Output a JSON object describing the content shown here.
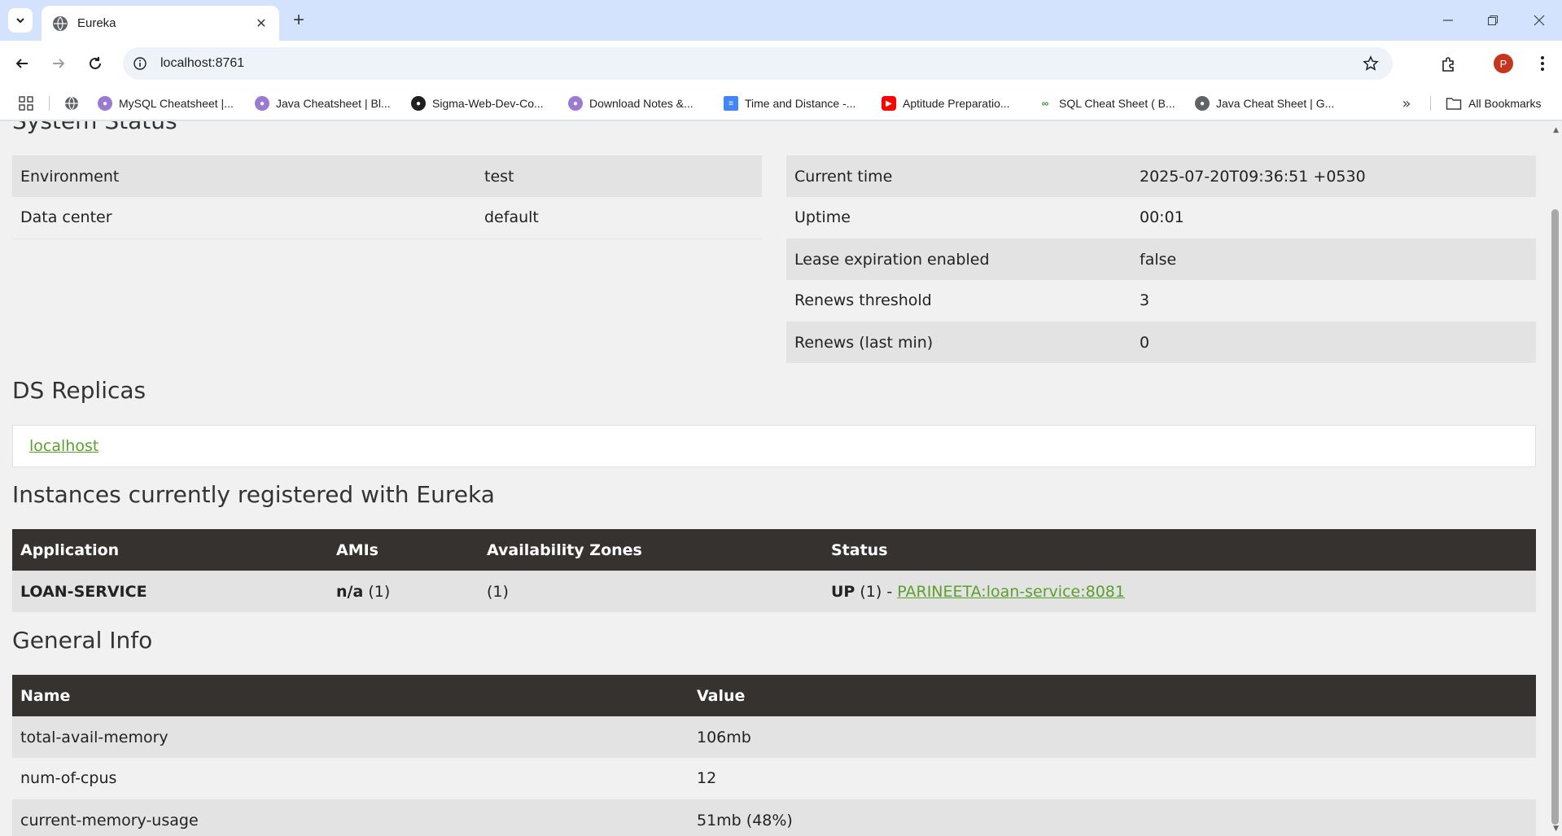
{
  "browser": {
    "tab_title": "Eureka",
    "url": "localhost:8761",
    "profile_initial": "P",
    "bookmarks": [
      {
        "label": "MySQL Cheatsheet |...",
        "icon": "avatar"
      },
      {
        "label": "Java Cheatsheet | Bl...",
        "icon": "avatar"
      },
      {
        "label": "Sigma-Web-Dev-Co...",
        "icon": "github"
      },
      {
        "label": "Download Notes &...",
        "icon": "avatar"
      },
      {
        "label": "Time and Distance -...",
        "icon": "docs"
      },
      {
        "label": "Aptitude Preparatio...",
        "icon": "youtube"
      },
      {
        "label": "SQL Cheat Sheet ( B...",
        "icon": "gfg"
      },
      {
        "label": "Java Cheat Sheet | G...",
        "icon": "globe"
      }
    ],
    "all_bookmarks_label": "All Bookmarks"
  },
  "system_status": {
    "title": "System Status",
    "left_rows": [
      {
        "name": "Environment",
        "value": "test"
      },
      {
        "name": "Data center",
        "value": "default"
      }
    ],
    "right_rows": [
      {
        "name": "Current time",
        "value": "2025-07-20T09:36:51 +0530"
      },
      {
        "name": "Uptime",
        "value": "00:01"
      },
      {
        "name": "Lease expiration enabled",
        "value": "false"
      },
      {
        "name": "Renews threshold",
        "value": "3"
      },
      {
        "name": "Renews (last min)",
        "value": "0"
      }
    ]
  },
  "ds_replicas": {
    "title": "DS Replicas",
    "link": "localhost"
  },
  "instances": {
    "title": "Instances currently registered with Eureka",
    "headers": {
      "application": "Application",
      "amis": "AMIs",
      "zones": "Availability Zones",
      "status": "Status"
    },
    "row": {
      "application": "LOAN-SERVICE",
      "amis_bold": "n/a",
      "amis_count": " (1)",
      "zones": "(1)",
      "status_bold": "UP",
      "status_count": " (1) - ",
      "status_link": "PARINEETA:loan-service:8081"
    }
  },
  "general_info": {
    "title": "General Info",
    "headers": {
      "name": "Name",
      "value": "Value"
    },
    "rows": [
      {
        "name": "total-avail-memory",
        "value": "106mb"
      },
      {
        "name": "num-of-cpus",
        "value": "12"
      },
      {
        "name": "current-memory-usage",
        "value": "51mb (48%)"
      }
    ]
  },
  "colors": {
    "link_green": "#5aa02c",
    "header_dark": "#363230",
    "stripe": "#e3e3e3",
    "page_bg": "#f1f1f1"
  }
}
